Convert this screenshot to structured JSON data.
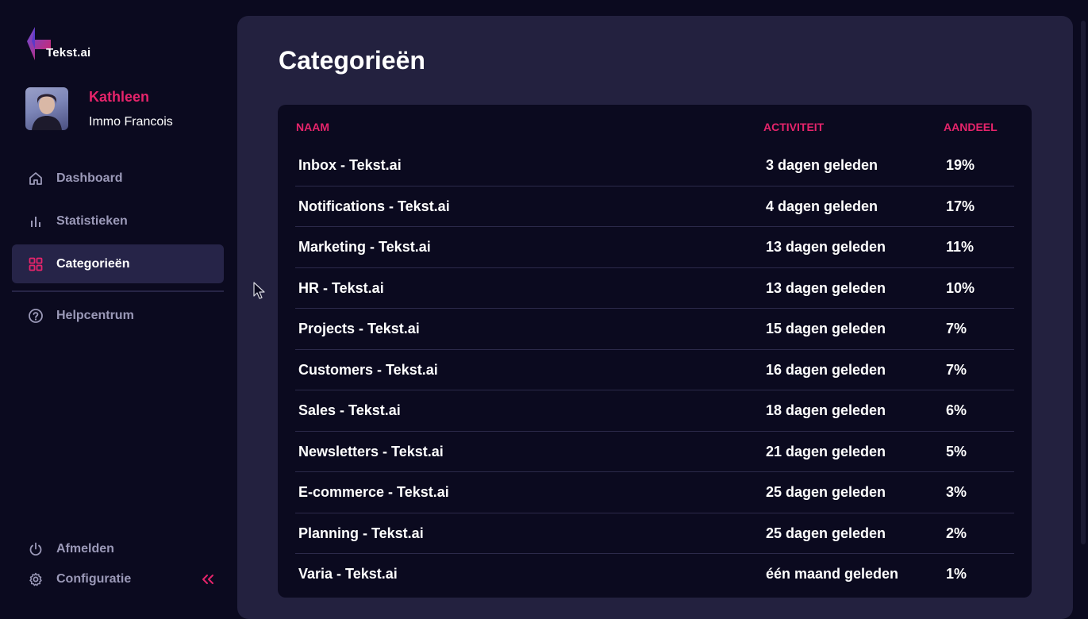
{
  "app": {
    "logo_text": "Tekst.ai"
  },
  "user": {
    "name": "Kathleen",
    "company": "Immo Francois"
  },
  "nav": {
    "items": [
      {
        "label": "Dashboard",
        "icon": "home-icon",
        "active": false
      },
      {
        "label": "Statistieken",
        "icon": "bar-chart-icon",
        "active": false
      },
      {
        "label": "Categorieën",
        "icon": "grid-icon",
        "active": true
      }
    ],
    "help": {
      "label": "Helpcentrum",
      "icon": "help-circle-icon"
    },
    "logout": {
      "label": "Afmelden",
      "icon": "power-icon"
    },
    "config": {
      "label": "Configuratie",
      "icon": "gear-icon"
    },
    "collapse_icon": "double-chevron-left-icon"
  },
  "page": {
    "title": "Categorieën"
  },
  "table": {
    "headers": {
      "naam": "NAAM",
      "activiteit": "ACTIVITEIT",
      "aandeel": "AANDEEL"
    },
    "rows": [
      {
        "naam": "Inbox - Tekst.ai",
        "activiteit": "3 dagen geleden",
        "aandeel": "19%"
      },
      {
        "naam": "Notifications - Tekst.ai",
        "activiteit": "4 dagen geleden",
        "aandeel": "17%"
      },
      {
        "naam": "Marketing - Tekst.ai",
        "activiteit": "13 dagen geleden",
        "aandeel": "11%"
      },
      {
        "naam": "HR - Tekst.ai",
        "activiteit": "13 dagen geleden",
        "aandeel": "10%"
      },
      {
        "naam": "Projects - Tekst.ai",
        "activiteit": "15 dagen geleden",
        "aandeel": "7%"
      },
      {
        "naam": "Customers - Tekst.ai",
        "activiteit": "16 dagen geleden",
        "aandeel": "7%"
      },
      {
        "naam": "Sales - Tekst.ai",
        "activiteit": "18 dagen geleden",
        "aandeel": "6%"
      },
      {
        "naam": "Newsletters - Tekst.ai",
        "activiteit": "21 dagen geleden",
        "aandeel": "5%"
      },
      {
        "naam": "E-commerce - Tekst.ai",
        "activiteit": "25 dagen geleden",
        "aandeel": "3%"
      },
      {
        "naam": "Planning - Tekst.ai",
        "activiteit": "25 dagen geleden",
        "aandeel": "2%"
      },
      {
        "naam": "Varia - Tekst.ai",
        "activiteit": "één maand geleden",
        "aandeel": "1%"
      }
    ]
  },
  "colors": {
    "accent": "#e6246b",
    "background": "#0b0a1f",
    "panel": "#23213f",
    "nav_active": "#262448",
    "muted_text": "#9b99b8"
  }
}
